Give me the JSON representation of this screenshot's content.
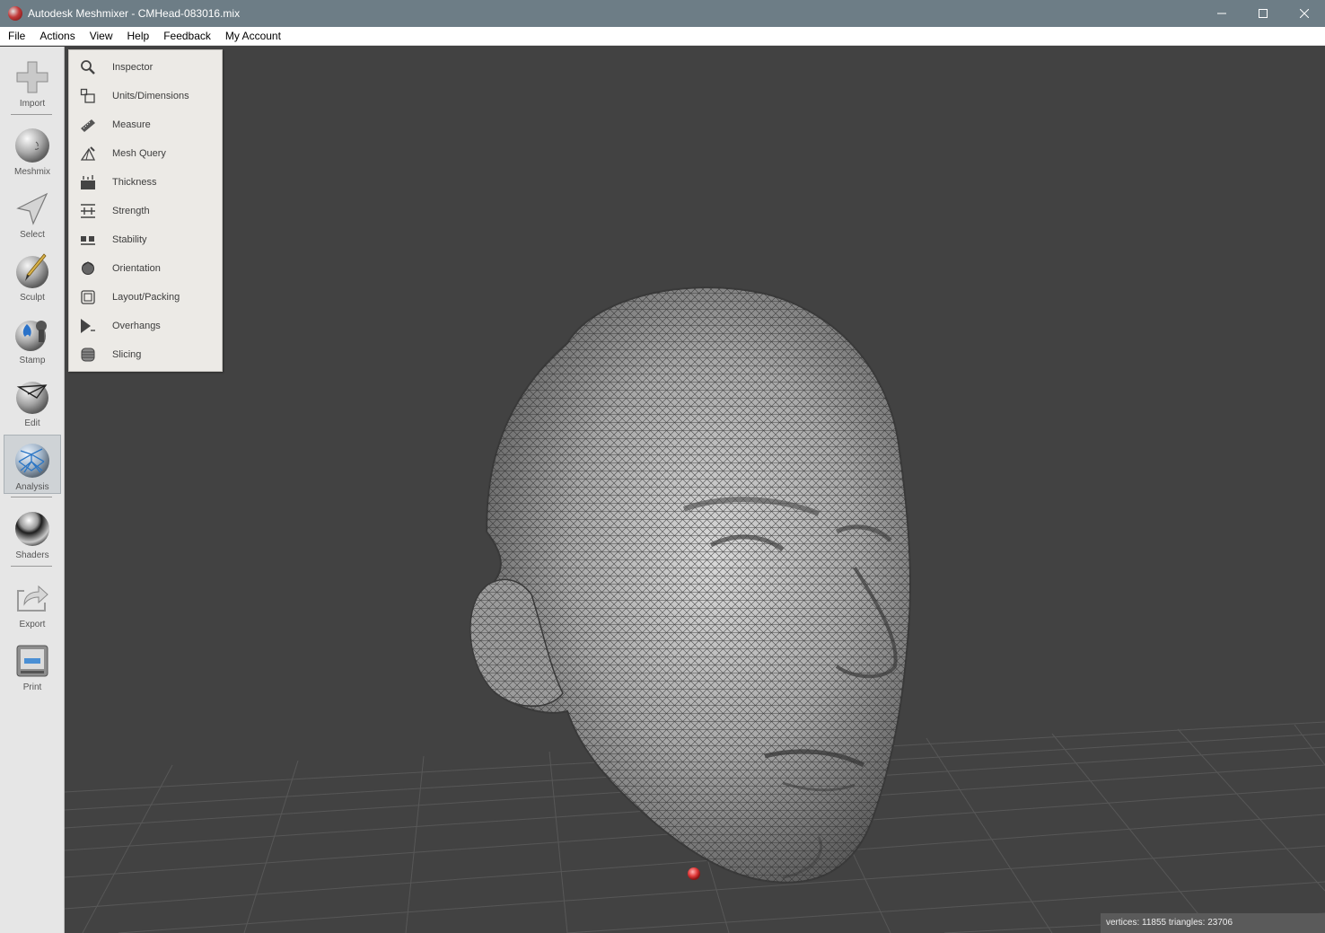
{
  "window": {
    "title": "Autodesk Meshmixer - CMHead-083016.mix",
    "controls": {
      "minimize": "─",
      "maximize": "☐",
      "close": "✕"
    }
  },
  "menubar": {
    "items": [
      "File",
      "Actions",
      "View",
      "Help",
      "Feedback",
      "My Account"
    ]
  },
  "toolbar": {
    "tools": [
      {
        "label": "Import",
        "icon": "plus-icon"
      },
      {
        "label": "Meshmix",
        "icon": "meshmix-sphere-icon"
      },
      {
        "label": "Select",
        "icon": "arrow-cursor-icon"
      },
      {
        "label": "Sculpt",
        "icon": "sculpt-brush-icon"
      },
      {
        "label": "Stamp",
        "icon": "stamp-icon"
      },
      {
        "label": "Edit",
        "icon": "edit-sphere-icon"
      },
      {
        "label": "Analysis",
        "icon": "analysis-mesh-icon",
        "active": true
      },
      {
        "label": "Shaders",
        "icon": "shader-sphere-icon"
      },
      {
        "label": "Export",
        "icon": "export-icon"
      },
      {
        "label": "Print",
        "icon": "printer-icon"
      }
    ]
  },
  "analysis_menu": {
    "items": [
      {
        "label": "Inspector",
        "icon": "magnifier-icon"
      },
      {
        "label": "Units/Dimensions",
        "icon": "units-icon"
      },
      {
        "label": "Measure",
        "icon": "ruler-icon"
      },
      {
        "label": "Mesh Query",
        "icon": "mesh-query-icon"
      },
      {
        "label": "Thickness",
        "icon": "thickness-icon"
      },
      {
        "label": "Strength",
        "icon": "strength-icon"
      },
      {
        "label": "Stability",
        "icon": "stability-icon"
      },
      {
        "label": "Orientation",
        "icon": "orientation-icon"
      },
      {
        "label": "Layout/Packing",
        "icon": "layout-packing-icon"
      },
      {
        "label": "Overhangs",
        "icon": "overhangs-icon"
      },
      {
        "label": "Slicing",
        "icon": "slicing-icon"
      }
    ]
  },
  "status": {
    "text": "vertices: 11855 triangles: 23706"
  },
  "colors": {
    "titlebar": "#6d7d86",
    "viewport": "#424242",
    "toolbar": "#e6e6e6",
    "popup": "#eceae6",
    "pivot_marker": "#e23a3a"
  }
}
